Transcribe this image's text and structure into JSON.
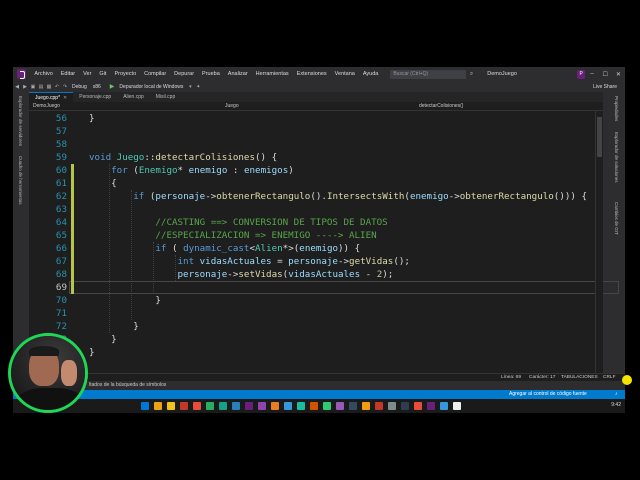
{
  "menu": {
    "items": [
      "Archivo",
      "Editar",
      "Ver",
      "Git",
      "Proyecto",
      "Compilar",
      "Depurar",
      "Prueba",
      "Analizar",
      "Herramientas",
      "Extensiones",
      "Ventana",
      "Ayuda"
    ],
    "search_placeholder": "Buscar (Ctrl+Q)",
    "solution_name": "DemoJuego",
    "avatar_letter": "P"
  },
  "toolbar": {
    "config": "Debug",
    "platform": "x86",
    "debugger_label": "Depurador local de Windows",
    "live_share": "Live Share"
  },
  "left_rail": [
    "Explorador de servidores",
    "Cuadro de herramientas"
  ],
  "right_rail": [
    "Propiedades",
    "Explorador de soluciones",
    "Cambios de GIT"
  ],
  "tabs": [
    {
      "label": "Juego.cpp*",
      "active": true
    },
    {
      "label": "Personaje.cpp",
      "active": false
    },
    {
      "label": "Alien.cpp",
      "active": false
    },
    {
      "label": "Misil.cpp",
      "active": false
    }
  ],
  "navbar": {
    "project": "DemoJuego",
    "scope": "Juego",
    "member": "detectarColisiones()"
  },
  "editor": {
    "current_line": 69,
    "lines": [
      {
        "n": "56",
        "tokens": [
          [
            "p",
            "}"
          ]
        ]
      },
      {
        "n": "57",
        "tokens": []
      },
      {
        "n": "58",
        "tokens": []
      },
      {
        "n": "59",
        "tokens": [
          [
            "k",
            "void "
          ],
          [
            "t",
            "Juego"
          ],
          [
            "p",
            "::"
          ],
          [
            "f",
            "detectarColisiones"
          ],
          [
            "p",
            "() {"
          ]
        ]
      },
      {
        "n": "60",
        "tokens": [
          [
            "k",
            "    for "
          ],
          [
            "p",
            "("
          ],
          [
            "t",
            "Enemigo"
          ],
          [
            "p",
            "* "
          ],
          [
            "v",
            "enemigo"
          ],
          [
            "p",
            " : "
          ],
          [
            "v",
            "enemigos"
          ],
          [
            "p",
            ")"
          ]
        ]
      },
      {
        "n": "61",
        "tokens": [
          [
            "p",
            "    {"
          ]
        ]
      },
      {
        "n": "62",
        "tokens": [
          [
            "k",
            "        if "
          ],
          [
            "p",
            "("
          ],
          [
            "v",
            "personaje"
          ],
          [
            "p",
            "->"
          ],
          [
            "f",
            "obtenerRectangulo"
          ],
          [
            "p",
            "()."
          ],
          [
            "f",
            "IntersectsWith"
          ],
          [
            "p",
            "("
          ],
          [
            "v",
            "enemigo"
          ],
          [
            "p",
            "->"
          ],
          [
            "f",
            "obtenerRectangulo"
          ],
          [
            "p",
            "())) {"
          ]
        ]
      },
      {
        "n": "63",
        "tokens": []
      },
      {
        "n": "64",
        "tokens": [
          [
            "c",
            "            //CASTING ==> CONVERSION DE TIPOS DE DATOS"
          ]
        ]
      },
      {
        "n": "65",
        "tokens": [
          [
            "c",
            "            //ESPECIALIZACION => ENEMIGO ----> ALIEN"
          ]
        ]
      },
      {
        "n": "66",
        "tokens": [
          [
            "k",
            "            if "
          ],
          [
            "p",
            "( "
          ],
          [
            "k",
            "dynamic_cast"
          ],
          [
            "p",
            "<"
          ],
          [
            "t",
            "Alien"
          ],
          [
            "p",
            "*>("
          ],
          [
            "v",
            "enemigo"
          ],
          [
            "p",
            ")) {"
          ]
        ]
      },
      {
        "n": "67",
        "tokens": [
          [
            "k",
            "                int "
          ],
          [
            "v",
            "vidasActuales"
          ],
          [
            "p",
            " = "
          ],
          [
            "v",
            "personaje"
          ],
          [
            "p",
            "->"
          ],
          [
            "f",
            "getVidas"
          ],
          [
            "p",
            "();"
          ]
        ]
      },
      {
        "n": "68",
        "tokens": [
          [
            "v",
            "                personaje"
          ],
          [
            "p",
            "->"
          ],
          [
            "f",
            "setVidas"
          ],
          [
            "p",
            "("
          ],
          [
            "v",
            "vidasActuales"
          ],
          [
            "p",
            " - "
          ],
          [
            "n",
            "2"
          ],
          [
            "p",
            ");"
          ]
        ]
      },
      {
        "n": "69",
        "tokens": []
      },
      {
        "n": "70",
        "tokens": [
          [
            "p",
            "            }"
          ]
        ]
      },
      {
        "n": "71",
        "tokens": []
      },
      {
        "n": "72",
        "tokens": [
          [
            "p",
            "        }"
          ]
        ]
      },
      {
        "n": "73",
        "tokens": [
          [
            "p",
            "    }"
          ]
        ]
      },
      {
        "n": "74",
        "tokens": [
          [
            "p",
            "}"
          ]
        ]
      }
    ]
  },
  "edit_status": {
    "issues": "on problemas",
    "line": "Línea: 69",
    "char": "Carácter: 17",
    "tabs": "TABULACIONES",
    "eol": "CRLF"
  },
  "output_strip": {
    "label": "ltados de la búsqueda de símbolos"
  },
  "statusbar": {
    "source_control": "Agregar al control de código fuente"
  },
  "taskbar": {
    "icon_colors": [
      "#e8a317",
      "#f0c419",
      "#c0392b",
      "#e74c3c",
      "#27ae60",
      "#16a085",
      "#2980b9",
      "#68217a",
      "#8e44ad",
      "#e67e22",
      "#3498db",
      "#1abc9c",
      "#d35400",
      "#2ecc71",
      "#9b59b6",
      "#34495e",
      "#f39c12",
      "#c0392b",
      "#7f8c8d",
      "#2c3e50",
      "#e74c3c",
      "#68217a",
      "#3498db",
      "#ecf0f1"
    ],
    "time": "9:42"
  }
}
